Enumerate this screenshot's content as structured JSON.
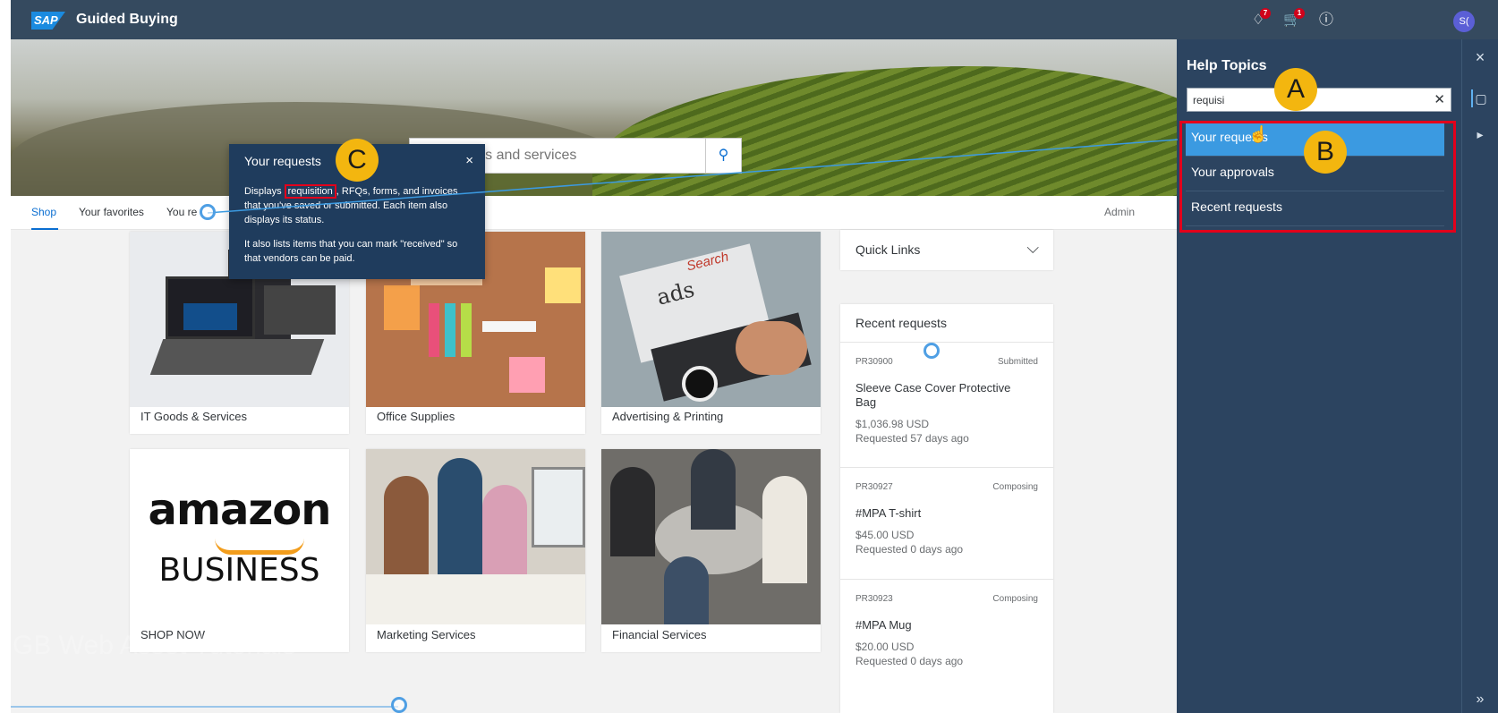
{
  "app": {
    "logo": "SAP",
    "title": "Guided Buying",
    "notifications_count": "7",
    "cart_count": "1",
    "avatar_initials": "S("
  },
  "icons": {
    "notifications": "bell-icon",
    "cart": "cart-icon",
    "help": "help-icon",
    "search": "search-icon",
    "close": "close-icon",
    "chevron": "chevron-down-icon",
    "chat": "chat-icon",
    "announce": "megaphone-icon",
    "expand": "double-chevron-right-icon"
  },
  "colors": {
    "shell": "#354a5f",
    "accent": "#0a6ed1",
    "help_panel": "#2c4460",
    "highlight_red": "#e3001b",
    "marker_yellow": "#f3b60f"
  },
  "search": {
    "placeholder": "Find goods and services"
  },
  "tabs": [
    {
      "label": "Shop",
      "active": true
    },
    {
      "label": "Your favorites"
    },
    {
      "label": "You re"
    }
  ],
  "admin_label": "Admin",
  "categories": [
    {
      "label": "IT Goods & Services"
    },
    {
      "label": "Office Supplies"
    },
    {
      "label": "Advertising & Printing"
    },
    {
      "label": "SHOP NOW"
    },
    {
      "label": "Marketing Services"
    },
    {
      "label": "Financial Services"
    }
  ],
  "amazon_card": {
    "word": "amazon",
    "business": "BUSINESS"
  },
  "ad_image": {
    "ads": "ads",
    "search": "Search"
  },
  "quick_links": {
    "title": "Quick Links",
    "chevron": "⌵"
  },
  "recent_requests": {
    "title": "Recent requests",
    "items": [
      {
        "id": "PR30900",
        "status": "Submitted",
        "name": "Sleeve Case Cover Protective Bag",
        "price": "$1,036.98 USD",
        "ago": "Requested 57 days ago"
      },
      {
        "id": "PR30927",
        "status": "Composing",
        "name": "#MPA T-shirt",
        "price": "$45.00 USD",
        "ago": "Requested 0 days ago"
      },
      {
        "id": "PR30923",
        "status": "Composing",
        "name": "#MPA Mug",
        "price": "$20.00 USD",
        "ago": "Requested 0 days ago"
      }
    ]
  },
  "help": {
    "title": "Help Topics",
    "search_value": "requisi",
    "clear": "✕",
    "results": [
      {
        "label": "Your requests",
        "active": true
      },
      {
        "label": "Your approvals"
      },
      {
        "label": "Recent requests"
      }
    ],
    "close": "×",
    "expand": "»"
  },
  "tooltip": {
    "title": "Your requests",
    "close": "×",
    "body_prefix": "Displays ",
    "highlight": "requisition",
    "body_suffix": ", RFQs, forms, and invoices that you've saved or submitted. Each item also displays its status.",
    "body2": "It also lists items that you can mark \"received\" so that vendors can be paid."
  },
  "markers": {
    "a": "A",
    "b": "B",
    "c": "C"
  },
  "watermark": "GB Web Asset Tutorials"
}
